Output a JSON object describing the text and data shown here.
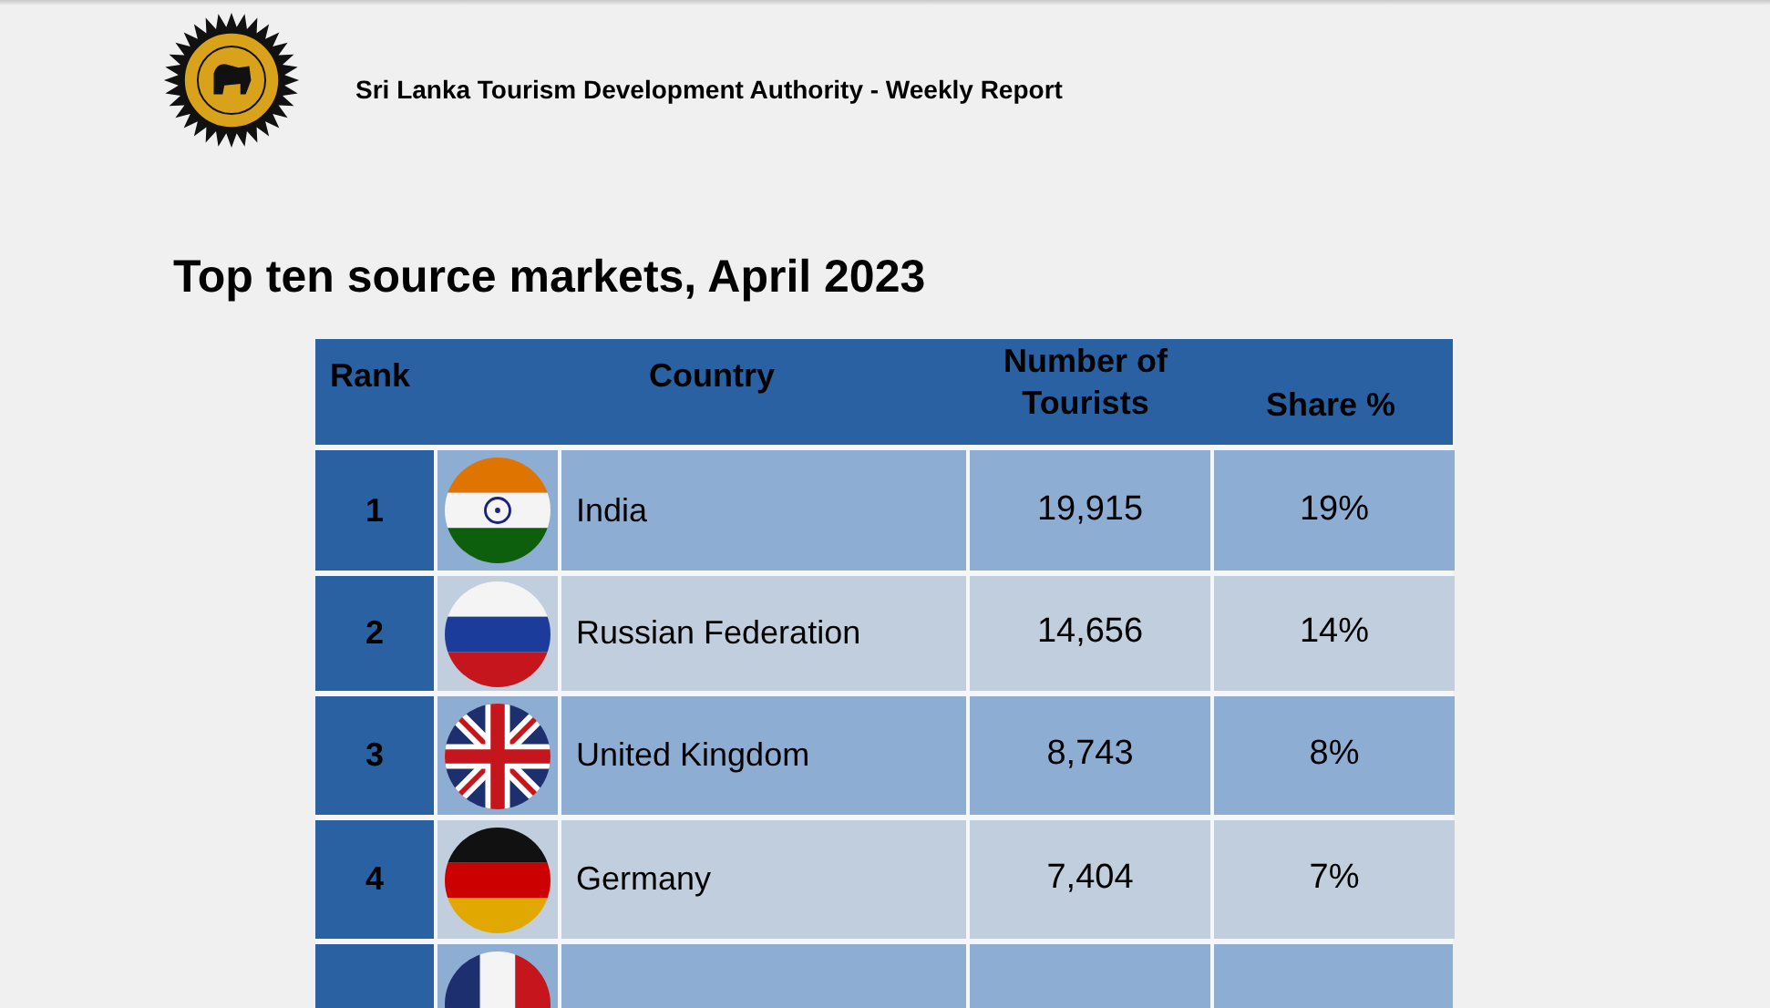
{
  "header": {
    "title": "Sri Lanka Tourism Development Authority - Weekly Report"
  },
  "heading": "Top ten source markets, April 2023",
  "table": {
    "columns": [
      "Rank",
      "Country",
      "Number of Tourists",
      "Share %"
    ],
    "rows": [
      {
        "rank": "1",
        "country": "India",
        "tourists": "19,915",
        "share": "19%"
      },
      {
        "rank": "2",
        "country": "Russian Federation",
        "tourists": "14,656",
        "share": "14%"
      },
      {
        "rank": "3",
        "country": "United Kingdom",
        "tourists": "8,743",
        "share": "8%"
      },
      {
        "rank": "4",
        "country": "Germany",
        "tourists": "7,404",
        "share": "7%"
      }
    ]
  }
}
